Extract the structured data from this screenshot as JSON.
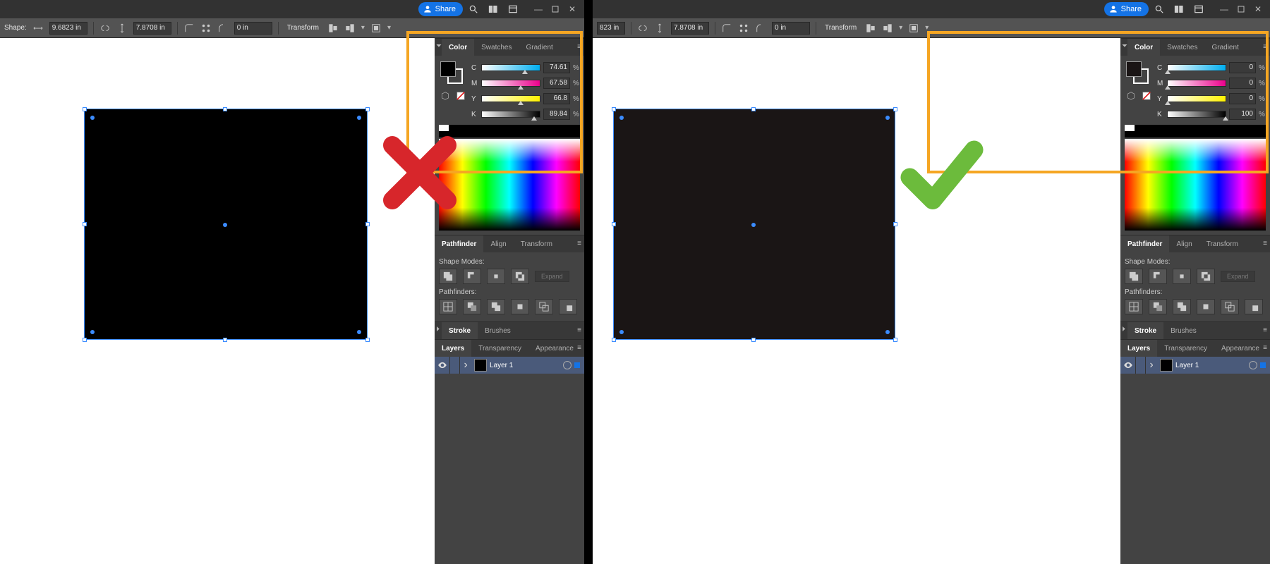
{
  "titlebar": {
    "share_label": "Share"
  },
  "options": {
    "shape_label": "Shape:",
    "width": "9.6823 in",
    "height": "7.8708 in",
    "corner": "0 in",
    "transform_label": "Transform",
    "width_right_trunc": "823 in"
  },
  "left": {
    "cmyk": {
      "C": "74.61",
      "M": "67.58",
      "Y": "66.8",
      "K": "89.84"
    },
    "fill_color": "#000000"
  },
  "right": {
    "cmyk": {
      "C": "0",
      "M": "0",
      "Y": "0",
      "K": "100"
    },
    "fill_color": "#1a1515"
  },
  "color_panel": {
    "tabs": {
      "color": "Color",
      "swatches": "Swatches",
      "gradient": "Gradient"
    },
    "pct": "%"
  },
  "pathfinder": {
    "tabs": {
      "pathfinder": "Pathfinder",
      "align": "Align",
      "transform": "Transform"
    },
    "shape_modes": "Shape Modes:",
    "pathfinders": "Pathfinders:",
    "expand": "Expand"
  },
  "stroke_panel": {
    "tabs": {
      "stroke": "Stroke",
      "brushes": "Brushes"
    }
  },
  "layers_panel": {
    "tabs": {
      "layers": "Layers",
      "transparency": "Transparency",
      "appearance": "Appearance"
    },
    "layer1": "Layer 1"
  },
  "channels": {
    "c": "C",
    "m": "M",
    "y": "Y",
    "k": "K"
  }
}
